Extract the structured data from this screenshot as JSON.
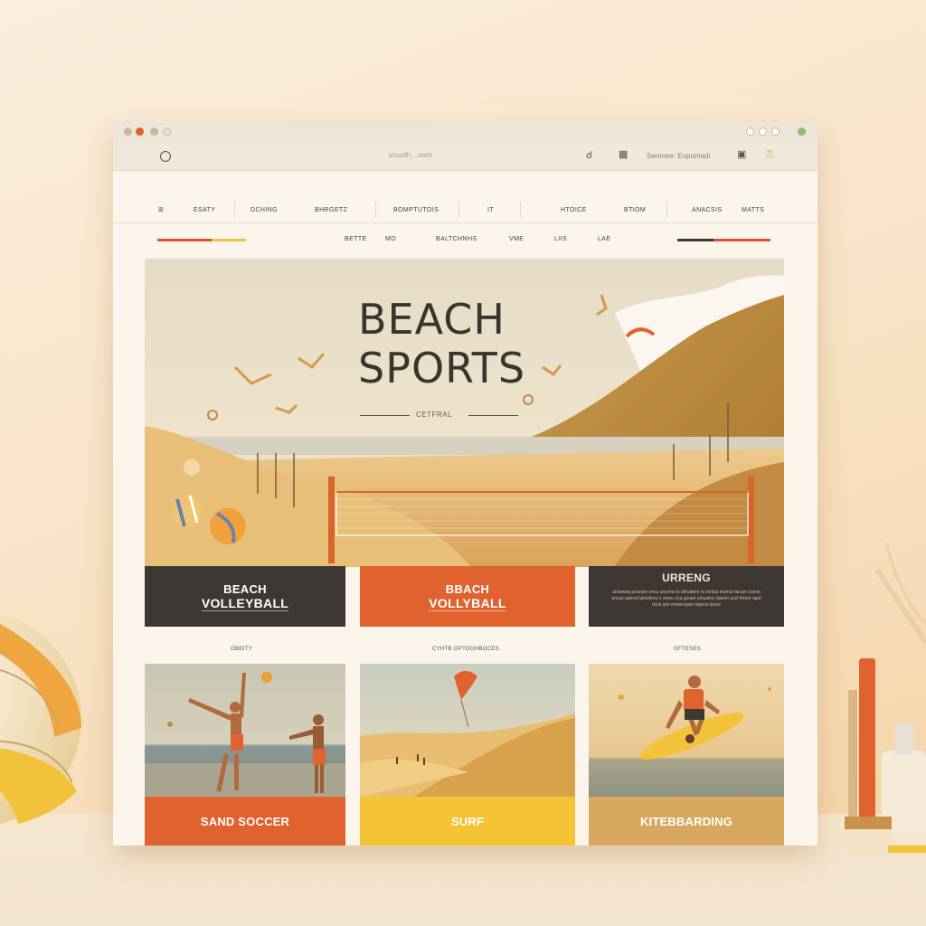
{
  "browser": {
    "address": "vouath…oom",
    "search_text": "Senmee: Eopumadi"
  },
  "nav_primary": [
    "ESATY",
    "DCHING",
    "BHRGETZ",
    "BOMPTUTOIS",
    "IT",
    "HTOICE",
    "BTIOM",
    "ANACSIS",
    "MATTS"
  ],
  "nav_secondary": [
    "BETTE",
    "MO",
    "BALTCHNHS",
    "VME",
    "LIIS",
    "LAE"
  ],
  "hero": {
    "title_line1": "BEACH",
    "title_line2": "SPORTS",
    "subtitle": "CETFRAL"
  },
  "banners": [
    {
      "line1": "BEACH",
      "line2": "VOLLEYBALL"
    },
    {
      "line1": "BBACH",
      "line2": "VOLLYBALL"
    },
    {
      "line1": "URRENG",
      "body": "ansiavea pounwe oncu unurmo is dimaitere is conlas inemut tacum cuone ancus aanvul tpnsieres s vmeu nca gsuee umusine stanon usyl tmore upot ticos ipm mmenopse ntpeno lpoce"
    }
  ],
  "captions": [
    "OBDITY",
    "CYHTB OPTOOHBOCES",
    "OFTESES"
  ],
  "sports": [
    {
      "label": "SAND SOCCER"
    },
    {
      "label": "SURF"
    },
    {
      "label": "KITEBBARDING"
    }
  ],
  "colors": {
    "dark": "#3d3834",
    "orange": "#e0622f",
    "yellow": "#f5c336",
    "tan": "#d9a860"
  }
}
